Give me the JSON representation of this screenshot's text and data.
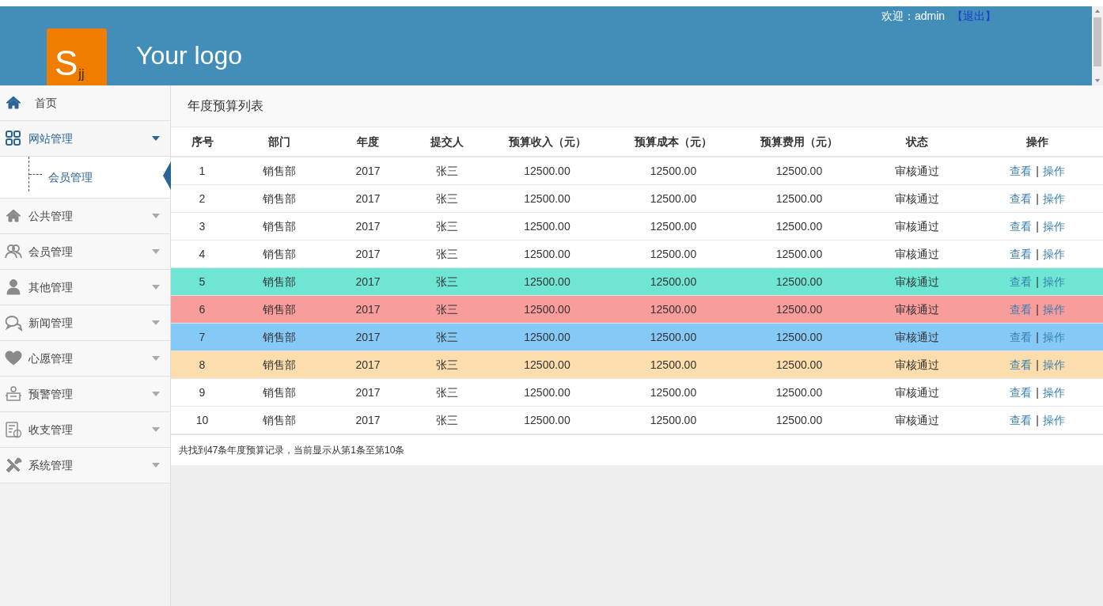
{
  "header": {
    "logo_letter": "S",
    "logo_sub": "jj",
    "logo_text": "Your logo",
    "welcome": "欢迎：admin",
    "logout": "【退出】"
  },
  "sidebar": {
    "items": [
      {
        "label": "首页",
        "selected": false,
        "kind": "link"
      },
      {
        "label": "网站管理",
        "selected": true,
        "expanded": true,
        "kind": "menu",
        "children": [
          {
            "label": "会员管理",
            "selected": true
          }
        ]
      },
      {
        "label": "公共管理",
        "selected": false,
        "expanded": false,
        "kind": "menu"
      },
      {
        "label": "会员管理",
        "selected": false,
        "expanded": false,
        "kind": "menu"
      },
      {
        "label": "其他管理",
        "selected": false,
        "expanded": false,
        "kind": "menu"
      },
      {
        "label": "新闻管理",
        "selected": false,
        "expanded": false,
        "kind": "menu"
      },
      {
        "label": "心愿管理",
        "selected": false,
        "expanded": false,
        "kind": "menu"
      },
      {
        "label": "预警管理",
        "selected": false,
        "expanded": false,
        "kind": "menu"
      },
      {
        "label": "收支管理",
        "selected": false,
        "expanded": false,
        "kind": "menu"
      },
      {
        "label": "系统管理",
        "selected": false,
        "expanded": false,
        "kind": "menu"
      }
    ]
  },
  "page_title": "年度预算列表",
  "table": {
    "columns": [
      "序号",
      "部门",
      "年度",
      "提交人",
      "预算收入（元）",
      "预算成本（元）",
      "预算费用（元）",
      "状态",
      "操作"
    ],
    "rows": [
      {
        "cells": [
          "1",
          "销售部",
          "2017",
          "张三",
          "12500.00",
          "12500.00",
          "12500.00",
          "审核通过"
        ],
        "actions": [
          "查看",
          "|",
          "操作"
        ]
      },
      {
        "cells": [
          "2",
          "销售部",
          "2017",
          "张三",
          "12500.00",
          "12500.00",
          "12500.00",
          "审核通过"
        ],
        "actions": [
          "查看",
          "|",
          "操作"
        ]
      },
      {
        "cells": [
          "3",
          "销售部",
          "2017",
          "张三",
          "12500.00",
          "12500.00",
          "12500.00",
          "审核通过"
        ],
        "actions": [
          "查看",
          "|",
          "操作"
        ]
      },
      {
        "cells": [
          "4",
          "销售部",
          "2017",
          "张三",
          "12500.00",
          "12500.00",
          "12500.00",
          "审核通过"
        ],
        "actions": [
          "查看",
          "|",
          "操作"
        ]
      },
      {
        "cells": [
          "5",
          "销售部",
          "2017",
          "张三",
          "12500.00",
          "12500.00",
          "12500.00",
          "审核通过"
        ],
        "actions": [
          "查看",
          "|",
          "操作"
        ],
        "color": "#6fe6d3"
      },
      {
        "cells": [
          "6",
          "销售部",
          "2017",
          "张三",
          "12500.00",
          "12500.00",
          "12500.00",
          "审核通过"
        ],
        "actions": [
          "查看",
          "|",
          "操作"
        ],
        "color": "#f99c9c"
      },
      {
        "cells": [
          "7",
          "销售部",
          "2017",
          "张三",
          "12500.00",
          "12500.00",
          "12500.00",
          "审核通过"
        ],
        "actions": [
          "查看",
          "|",
          "操作"
        ],
        "color": "#85c9f7"
      },
      {
        "cells": [
          "8",
          "销售部",
          "2017",
          "张三",
          "12500.00",
          "12500.00",
          "12500.00",
          "审核通过"
        ],
        "actions": [
          "查看",
          "|",
          "操作"
        ],
        "color": "#fcddad"
      },
      {
        "cells": [
          "9",
          "销售部",
          "2017",
          "张三",
          "12500.00",
          "12500.00",
          "12500.00",
          "审核通过"
        ],
        "actions": [
          "查看",
          "|",
          "操作"
        ]
      },
      {
        "cells": [
          "10",
          "销售部",
          "2017",
          "张三",
          "12500.00",
          "12500.00",
          "12500.00",
          "审核通过"
        ],
        "actions": [
          "查看",
          "|",
          "操作"
        ]
      }
    ]
  },
  "footer": "共找到47条年度预算记录，当前显示从第1条至第10条"
}
